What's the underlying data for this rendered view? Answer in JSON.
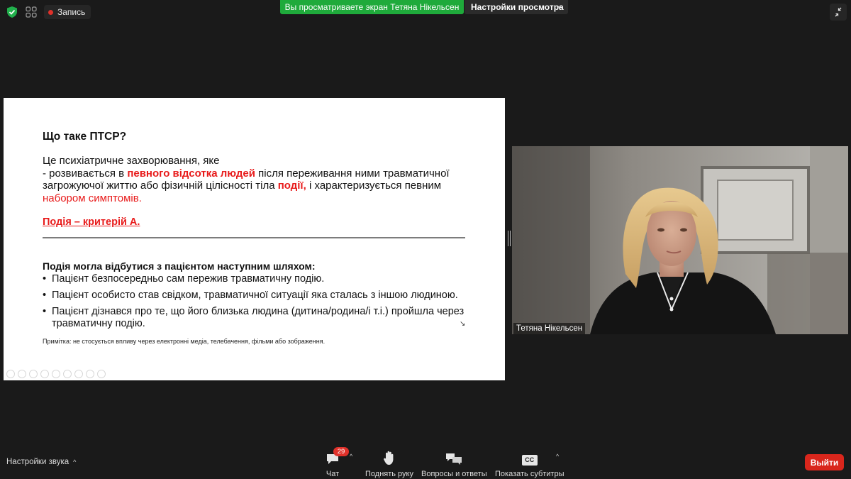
{
  "topbar": {
    "recording_label": "Запись",
    "share_banner": "Вы просматриваете экран Тетяна Нікельсен",
    "view_options_label": "Настройки просмотра"
  },
  "slide": {
    "title": "Що таке ПТСР?",
    "p_line1": "Це психіатричне захворювання, яке",
    "p_line2_a": "- розвивається в ",
    "p_line2_red": "певного відсотка людей",
    "p_line2_b": " після переживання ними травматичної",
    "p_line3_a": "загрожуючої життю або фізичній цілісності тіла ",
    "p_line3_red": "події,",
    "p_line3_b": " і характеризується певним",
    "p_line4_red": "набором симптомів.",
    "event_criterion": "Подія – критерій А.",
    "ways_heading": "Подія могла відбутися з пацієнтом наступним шляхом:",
    "bullets": [
      "Пацієнт безпосередньо сам пережив травматичну подію.",
      "Пацієнт особисто став свідком, травматичної ситуації яка сталась з іншою людиною.",
      "Пацієнт дізнався про те, що його близька людина (дитина/родина/і т.і.) пройшла через травматичну подію."
    ],
    "note": "Примітка: не стосується впливу через електронні медіа, телебачення, фільми або зображення."
  },
  "video": {
    "participant_name": "Тетяна Нікельсен"
  },
  "toolbar": {
    "audio_settings": "Настройки звука",
    "chat_label": "Чат",
    "chat_badge": "29",
    "raise_hand_label": "Поднять руку",
    "qa_label": "Вопросы и ответы",
    "captions_label": "Показать субтитры",
    "captions_icon_text": "CC",
    "leave_label": "Выйти"
  },
  "colors": {
    "background": "#1a1a1a",
    "share_green": "#1faa3b",
    "accent_red": "#e81b1b",
    "leave_red": "#d9261c",
    "badge_red": "#e0312a"
  }
}
